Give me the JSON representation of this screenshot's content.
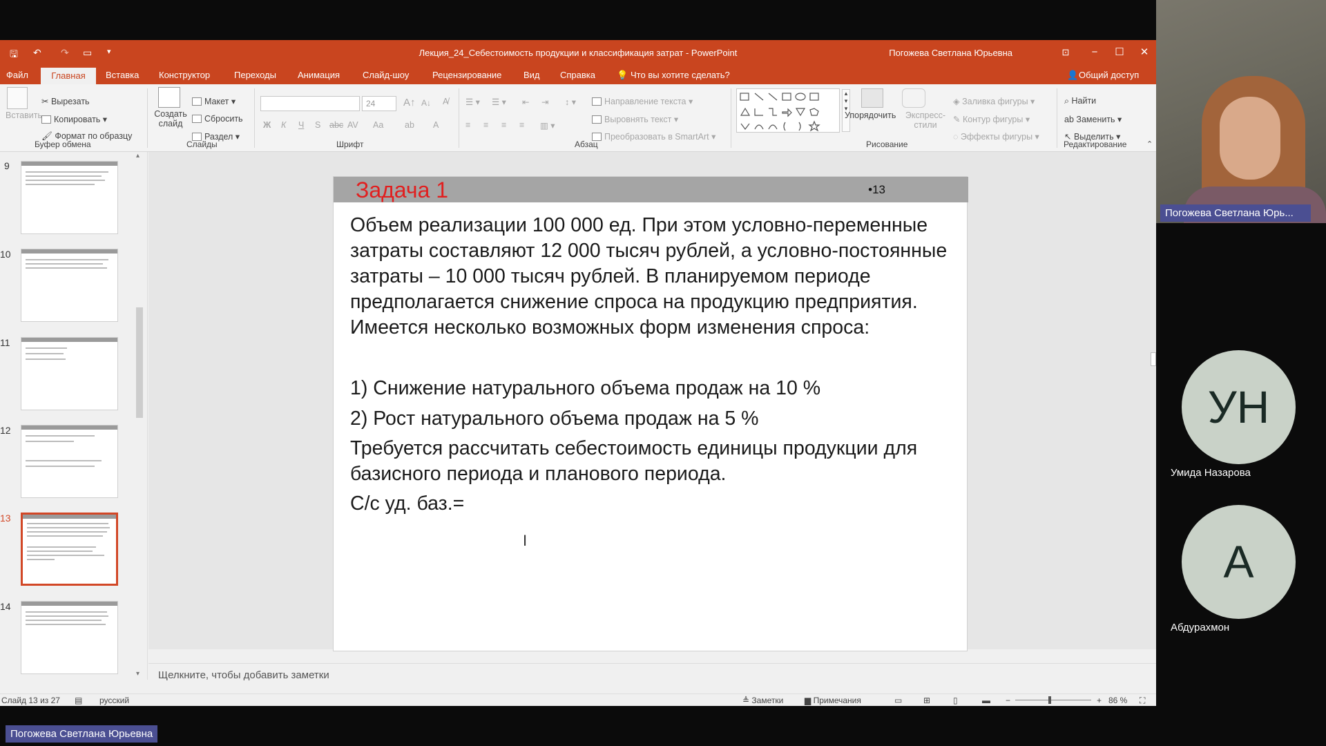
{
  "window": {
    "title": "Лекция_24_Себестоимость продукции и классификация затрат  -  PowerPoint",
    "user": "Погожева Светлана Юрьевна",
    "controls": [
      "−",
      "☐",
      "✕"
    ]
  },
  "menu": {
    "items": [
      "Файл",
      "Главная",
      "Вставка",
      "Конструктор",
      "Переходы",
      "Анимация",
      "Слайд-шоу",
      "Рецензирование",
      "Вид",
      "Справка"
    ],
    "tell_me": "Что вы хотите сделать?",
    "share": "Общий доступ"
  },
  "ribbon": {
    "clipboard": {
      "paste": "Вставить",
      "cut": "Вырезать",
      "copy": "Копировать",
      "format": "Формат по образцу",
      "group": "Буфер обмена"
    },
    "slides": {
      "new": "Создать слайд",
      "layout": "Макет",
      "reset": "Сбросить",
      "section": "Раздел",
      "group": "Слайды"
    },
    "font": {
      "size": "24",
      "group": "Шрифт"
    },
    "paragraph": {
      "direction": "Направление текста",
      "align": "Выровнять текст",
      "smartart": "Преобразовать в SmartArt",
      "group": "Абзац"
    },
    "drawing": {
      "arrange": "Упорядочить",
      "styles": "Экспресс-стили",
      "fill": "Заливка фигуры",
      "outline": "Контур фигуры",
      "effects": "Эффекты фигуры",
      "group": "Рисование"
    },
    "editing": {
      "find": "Найти",
      "replace": "Заменить",
      "select": "Выделить",
      "group": "Редактирование"
    }
  },
  "thumbnails": [
    "9",
    "10",
    "11",
    "12",
    "13",
    "14"
  ],
  "slide": {
    "title": "Задача 1",
    "number": "•13",
    "para1": "Объем реализации 100 000 ед.  При этом условно-переменные затраты составляют 12 000 тысяч рублей, а условно-постоянные затраты – 10 000 тысяч рублей. В планируемом периоде предполагается снижение спроса на продукцию предприятия. Имеется несколько возможных форм изменения спроса:",
    "item1": "1) Снижение натурального объема продаж на 10 %",
    "item2": "2) Рост натурального объема продаж на 5 %",
    "para2": "Требуется рассчитать себестоимость единицы продукции для базисного периода и планового периода.",
    "para3": "С/с уд. баз.="
  },
  "notes_placeholder": "Щелкните, чтобы добавить заметки",
  "status": {
    "slide": "Слайд 13 из 27",
    "language": "русский",
    "notes": "Заметки",
    "comments": "Примечания",
    "zoom": "86 %"
  },
  "participants": [
    {
      "name": "Погожева Светлана Юрь...",
      "type": "video"
    },
    {
      "initials": "УН",
      "name": "Умида Назарова"
    },
    {
      "initials": "А",
      "name": "Абдурахмон"
    }
  ],
  "presenter_label": "Погожева Светлана Юрьевна"
}
